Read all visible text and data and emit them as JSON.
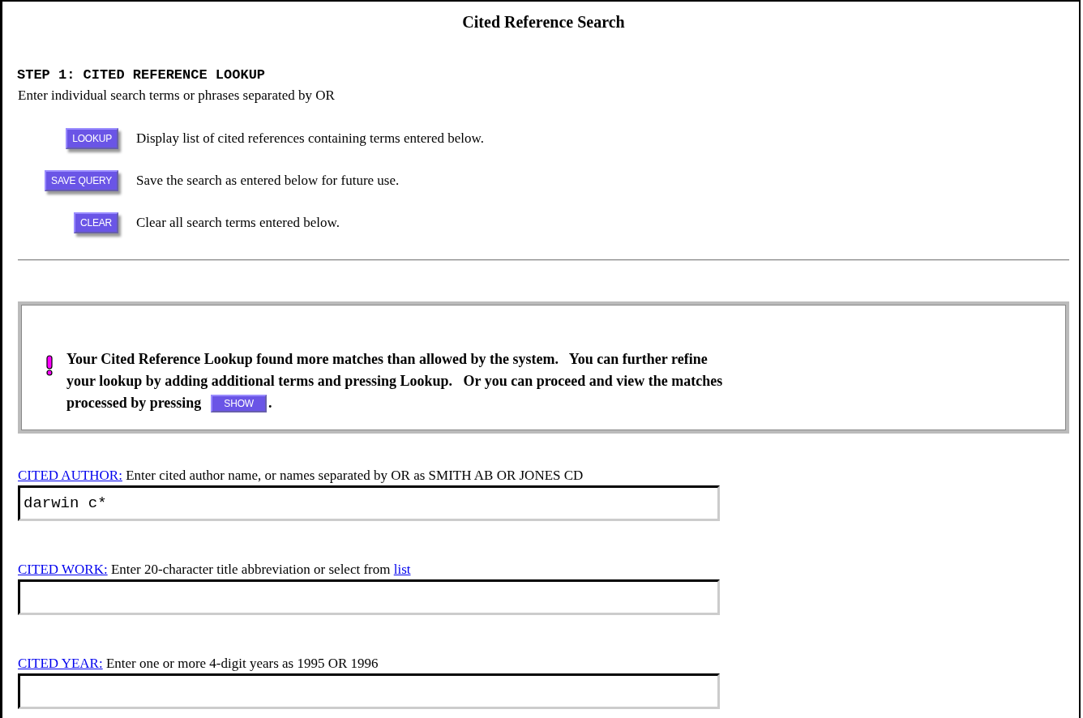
{
  "title": "Cited Reference Search",
  "step": {
    "heading": "STEP 1: CITED REFERENCE LOOKUP",
    "intro": "Enter individual search terms or phrases separated by OR",
    "actions": [
      {
        "button": "LOOKUP",
        "description": "Display list of cited references containing terms entered below."
      },
      {
        "button": "SAVE QUERY",
        "description": "Save the search as entered below for future use."
      },
      {
        "button": "CLEAR",
        "description": "Clear all search terms entered below."
      }
    ]
  },
  "notice": {
    "message_lines": [
      "Your Cited Reference Lookup found more matches than allowed by the system.   You can further refine",
      "your lookup by adding additional terms and pressing Lookup.   Or you can proceed and view the matches",
      "processed by pressing"
    ],
    "button": "SHOW",
    "end": "."
  },
  "fields": [
    {
      "label": "CITED AUTHOR:",
      "hint": "Enter cited author name, or names separated by OR as SMITH AB OR JONES CD",
      "value": "darwin c*"
    },
    {
      "label": "CITED WORK:",
      "hint": "Enter 20-character title abbreviation or select from",
      "hint_link": "list"
    },
    {
      "label": "CITED YEAR:",
      "hint": "Enter one or more 4-digit years as 1995 OR 1996"
    }
  ]
}
